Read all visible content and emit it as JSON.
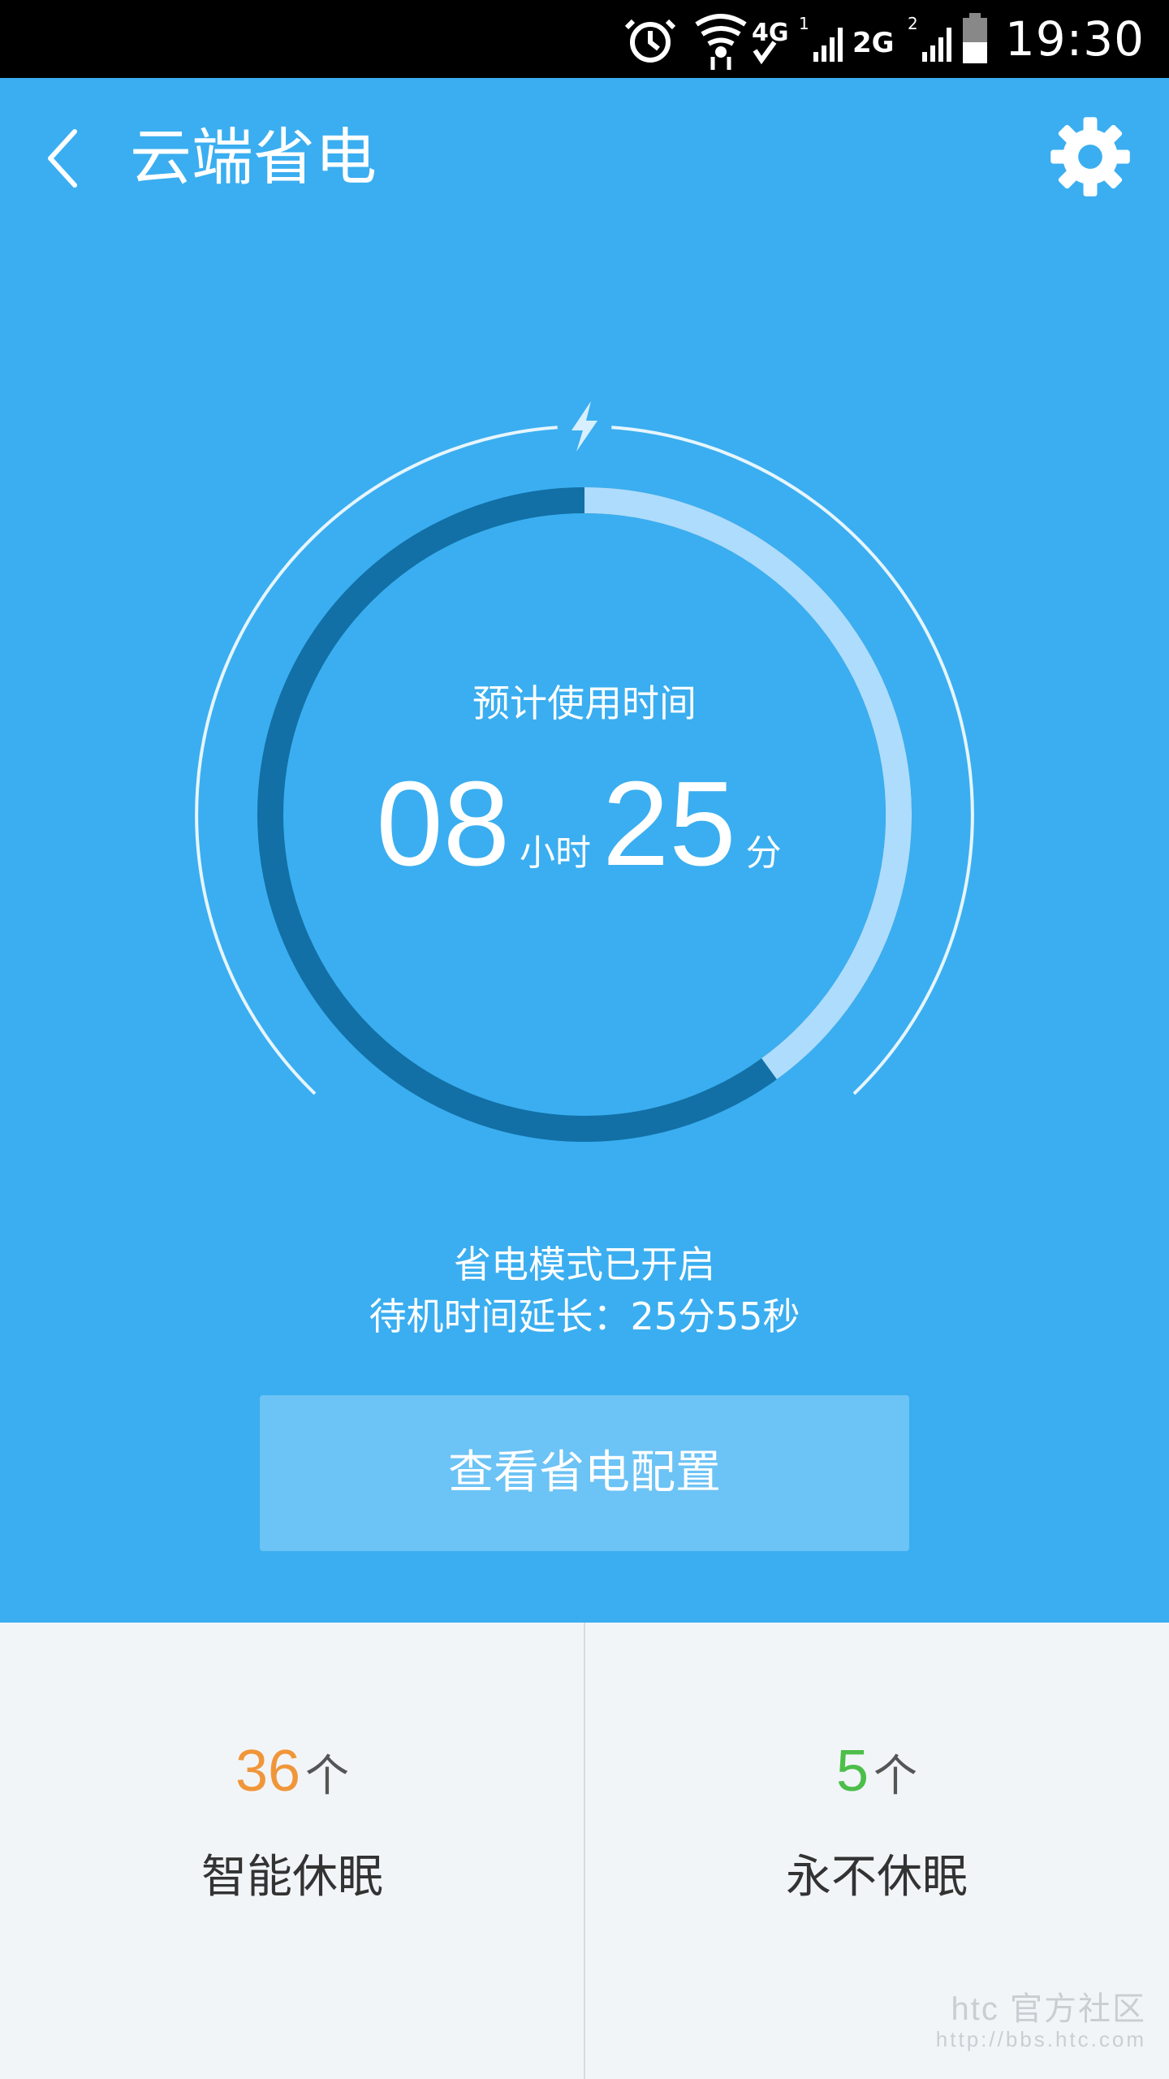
{
  "status_bar": {
    "time": "19:30",
    "icons": [
      "alarm-icon",
      "wifi-icon",
      "4g-icon",
      "signal-icon",
      "2g-icon",
      "signal-icon",
      "battery-icon"
    ],
    "network_4g": "4G",
    "network_2g": "2G"
  },
  "header": {
    "title": "云端省电",
    "back_icon": "back-icon",
    "settings_icon": "gear-icon"
  },
  "gauge": {
    "label": "预计使用时间",
    "hours": "08",
    "hours_unit": "小时",
    "minutes": "25",
    "minutes_unit": "分",
    "remaining_fraction": 0.4,
    "icon": "lightning-icon"
  },
  "mode": {
    "line1": "省电模式已开启",
    "line2": "待机时间延长：25分55秒"
  },
  "config_button": {
    "label": "查看省电配置"
  },
  "stats": [
    {
      "count": "36",
      "unit": "个",
      "label": "智能休眠",
      "color": "#f0963a"
    },
    {
      "count": "5",
      "unit": "个",
      "label": "永不休眠",
      "color": "#4cbe4a"
    }
  ],
  "watermark": {
    "line1": "htc 官方社区",
    "line2": "http://bbs.htc.com"
  },
  "colors": {
    "accent_blue": "#3aaef0",
    "ring_dark": "#1270a6",
    "ring_light": "#aedcfd",
    "button_bg": "#6cc3f5"
  }
}
